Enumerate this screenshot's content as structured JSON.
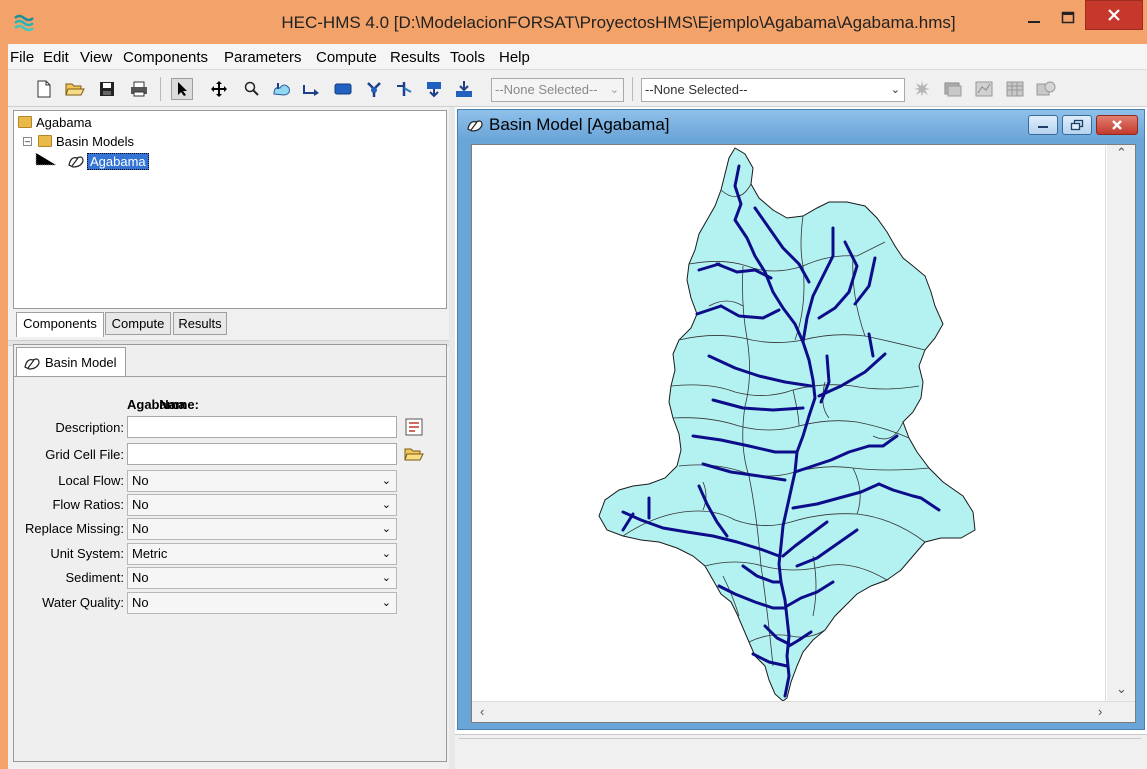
{
  "window": {
    "title": "HEC-HMS 4.0 [D:\\ModelacionFORSAT\\ProyectosHMS\\Ejemplo\\Agabama\\Agabama.hms]"
  },
  "menu": [
    "File",
    "Edit",
    "View",
    "Components",
    "Parameters",
    "Compute",
    "Results",
    "Tools",
    "Help"
  ],
  "toolbar": {
    "icons": [
      "new-file-icon",
      "open-folder-icon",
      "save-icon",
      "print-icon",
      "arrow-tool-icon",
      "pan-tool-icon",
      "zoom-tool-icon",
      "subbasin-tool-icon",
      "reach-tool-icon",
      "reservoir-tool-icon",
      "junction-tool-icon",
      "diversion-tool-icon",
      "source-tool-icon",
      "sink-tool-icon"
    ],
    "run_selector": "--None Selected--",
    "element_selector": "--None Selected--",
    "result_icons": [
      "compute-icon",
      "global-summary-icon",
      "graph-icon",
      "summary-table-icon",
      "time-series-table-icon"
    ]
  },
  "tree": {
    "root": "Agabama",
    "folder": "Basin Models",
    "selected_item": "Agabama"
  },
  "explorer_tabs": [
    "Components",
    "Compute",
    "Results"
  ],
  "properties": {
    "tab_label": "Basin Model",
    "name_label": "Name:",
    "name_value": "Agabama",
    "description_label": "Description:",
    "description_value": "",
    "grid_cell_label": "Grid Cell File:",
    "grid_cell_value": "",
    "rows": [
      {
        "label": "Local Flow:",
        "value": "No"
      },
      {
        "label": "Flow Ratios:",
        "value": "No"
      },
      {
        "label": "Replace Missing:",
        "value": "No"
      },
      {
        "label": "Unit System:",
        "value": "Metric"
      },
      {
        "label": "Sediment:",
        "value": "No"
      },
      {
        "label": "Water Quality:",
        "value": "No"
      }
    ]
  },
  "map_window": {
    "title": "Basin Model [Agabama]",
    "basin_fill": "#b4f2f2",
    "river_color": "#0d0d8a"
  }
}
